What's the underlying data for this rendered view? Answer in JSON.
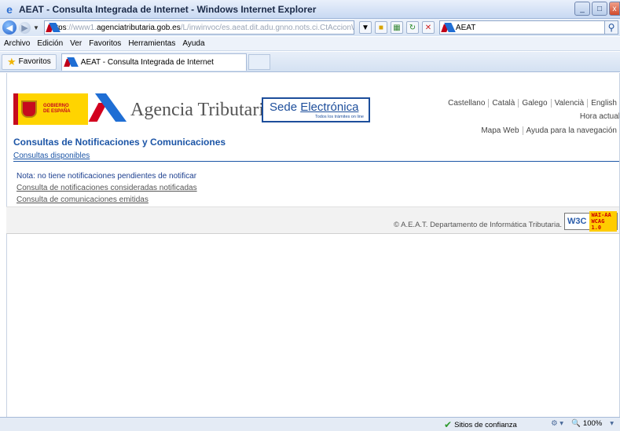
{
  "window": {
    "title": "AEAT - Consulta Integrada de Internet - Windows Internet Explorer",
    "controls": [
      "_",
      "□",
      "x"
    ]
  },
  "address": {
    "scheme": "https",
    "url_pre": "://www1.",
    "url_domain": "agenciatributaria.gob.es",
    "url_rest": "/L/inwinvoc/es.aeat.dit.adu.gnno.nots.ci.CtAccionW",
    "search_text": "AEAT"
  },
  "menu": [
    "Archivo",
    "Edición",
    "Ver",
    "Favoritos",
    "Herramientas",
    "Ayuda"
  ],
  "favorites": {
    "label": "Favoritos",
    "tab_title": "AEAT - Consulta Integrada de Internet"
  },
  "header": {
    "gob_text_1": "GOBIERNO",
    "gob_text_2": "DE ESPAÑA",
    "agency_name": "Agencia Tributaria",
    "sede_1": "Sede ",
    "sede_2": "Electrónica",
    "sede_tagline": "Todos los trámites on line",
    "languages": [
      "Castellano",
      "Català",
      "Galego",
      "Valencià",
      "English"
    ],
    "hora": "Hora actual",
    "links": [
      "Mapa Web",
      "Ayuda para la navegación"
    ]
  },
  "main": {
    "title": "Consultas de Notificaciones y Comunicaciones",
    "subtitle": "Consultas disponibles",
    "nota": "Nota: no tiene notificaciones pendientes de notificar",
    "link1": "Consulta de notificaciones consideradas notificadas",
    "link2": "Consulta de comunicaciones emitidas"
  },
  "footer": {
    "copyright": "© A.E.A.T. Departamento de Informática Tributaria.",
    "wai_w3c": "W3C",
    "wai_1": "WAI-AA",
    "wai_2": "WCAG 1.0"
  },
  "status": {
    "zone": "Sitios de confianza",
    "zoom": "100%"
  },
  "colors": {
    "link_blue": "#1c55a6",
    "ie_chrome": "#d4e1f2"
  }
}
